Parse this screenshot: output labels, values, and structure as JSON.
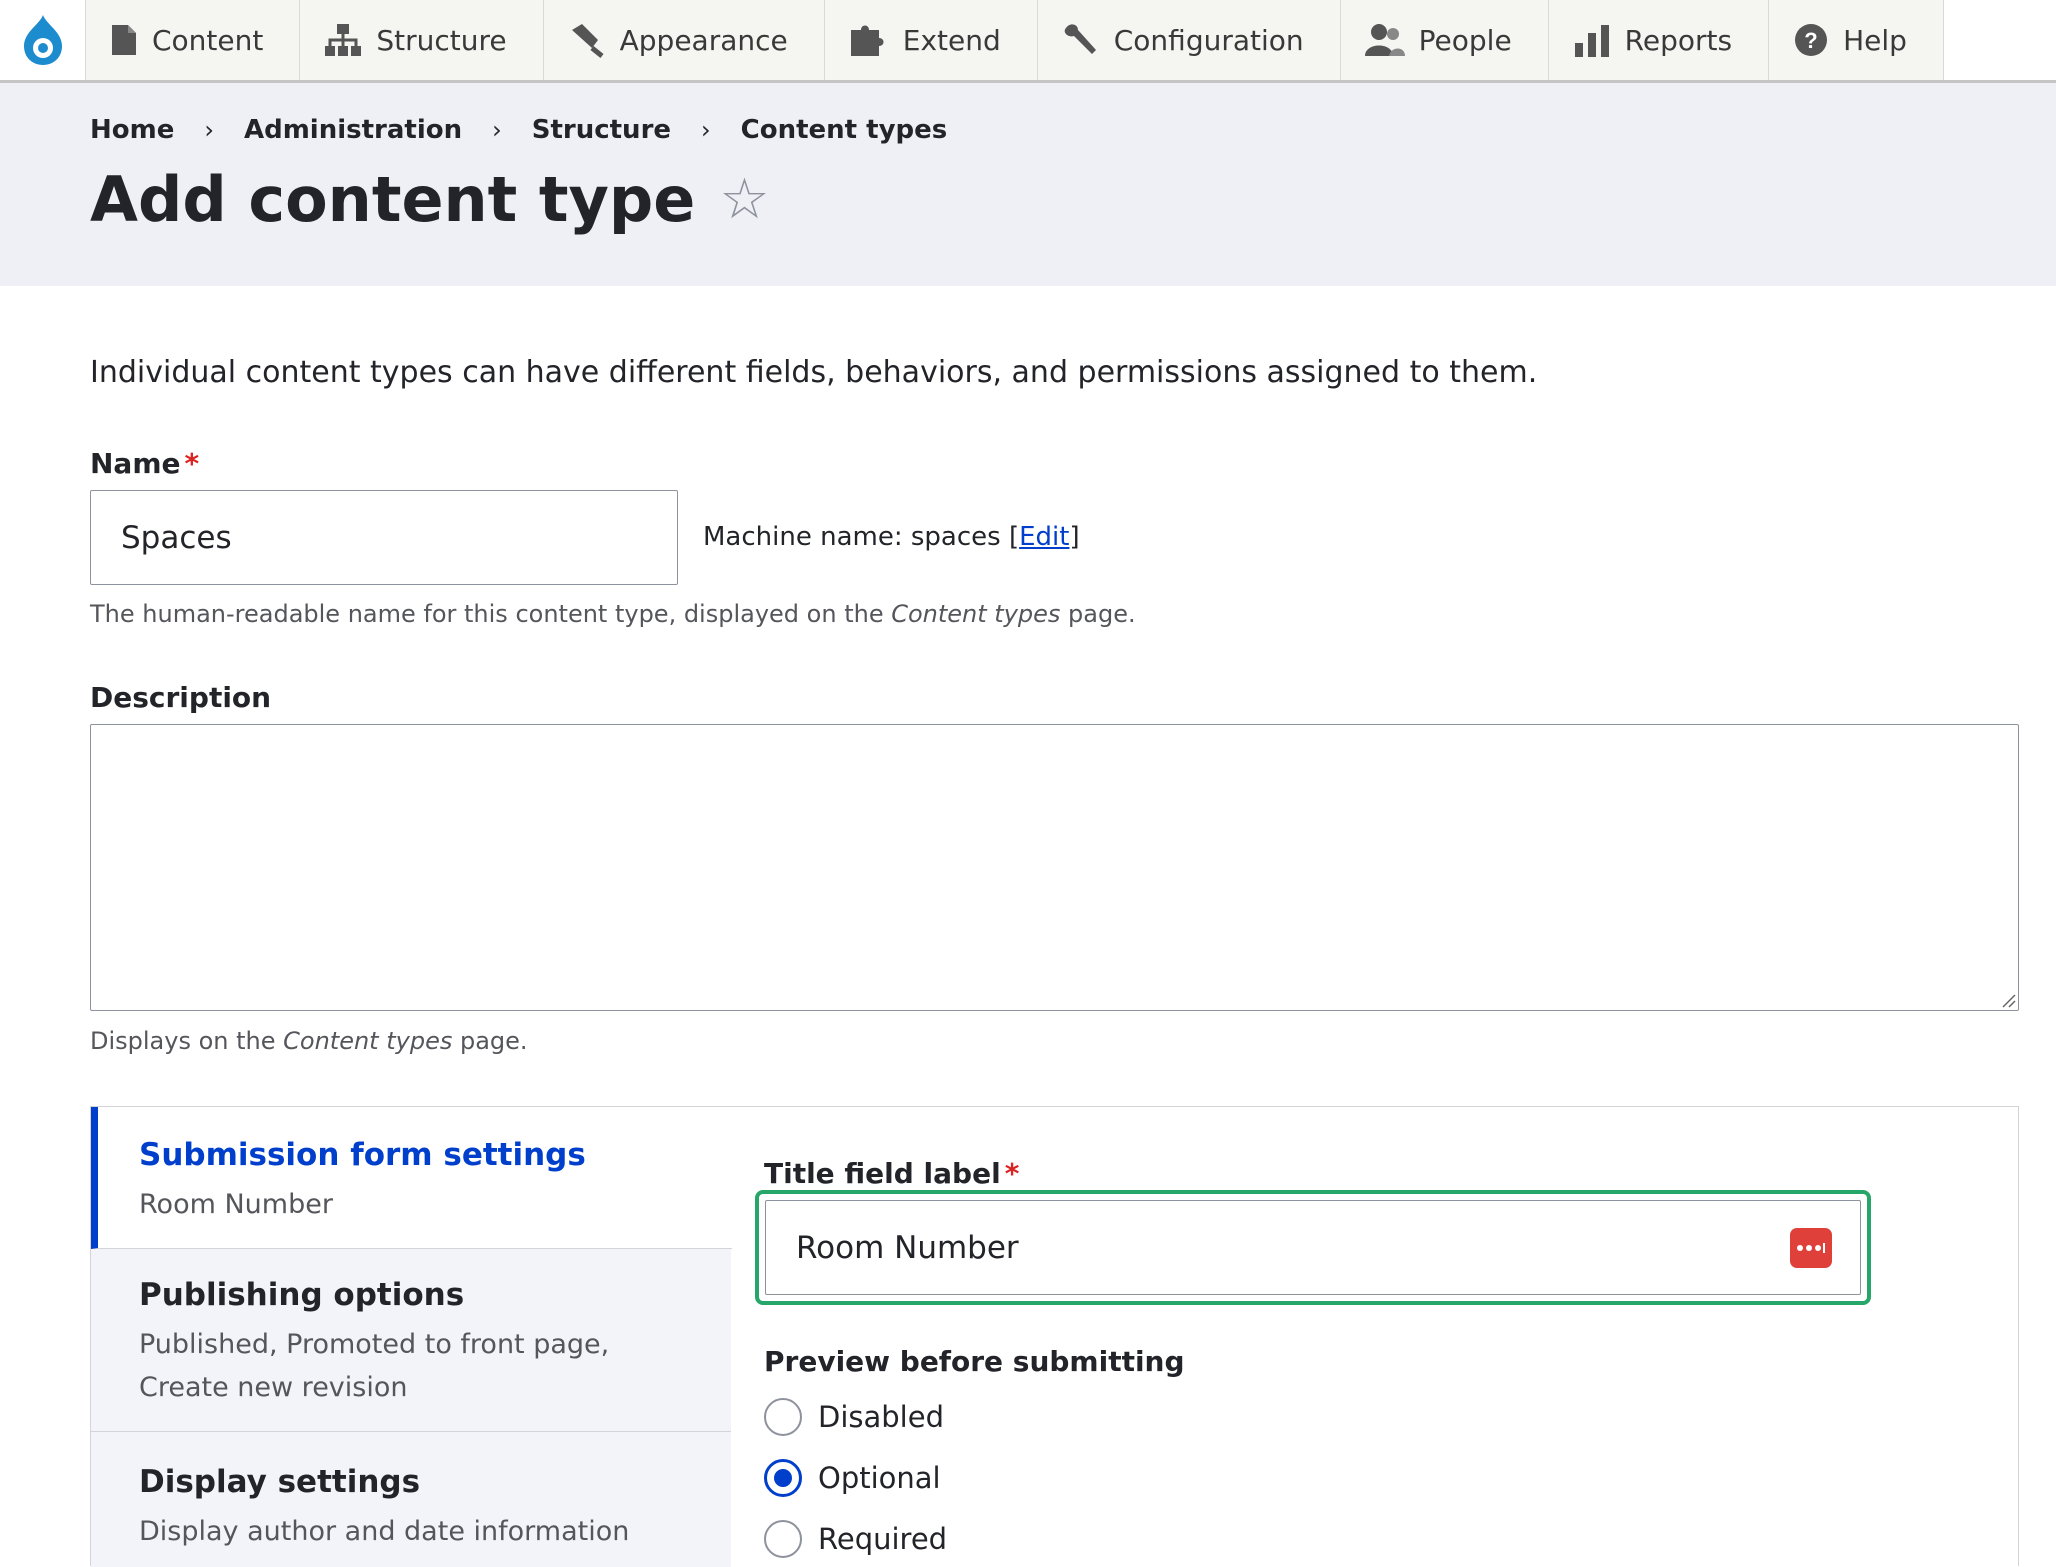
{
  "toolbar": {
    "items": [
      {
        "label": "Content",
        "icon": "file-icon"
      },
      {
        "label": "Structure",
        "icon": "sitemap-icon"
      },
      {
        "label": "Appearance",
        "icon": "paintbrush-icon"
      },
      {
        "label": "Extend",
        "icon": "puzzle-icon"
      },
      {
        "label": "Configuration",
        "icon": "wrench-icon"
      },
      {
        "label": "People",
        "icon": "people-icon"
      },
      {
        "label": "Reports",
        "icon": "bar-chart-icon"
      },
      {
        "label": "Help",
        "icon": "help-icon"
      }
    ]
  },
  "breadcrumb": [
    "Home",
    "Administration",
    "Structure",
    "Content types"
  ],
  "page": {
    "title": "Add content type",
    "intro": "Individual content types can have different fields, behaviors, and permissions assigned to them."
  },
  "form": {
    "name_label": "Name",
    "name_value": "Spaces",
    "machine_name_text": "Machine name: spaces",
    "machine_name_edit": "Edit",
    "name_help_prefix": "The human-readable name for this content type, displayed on the ",
    "name_help_em": "Content types",
    "name_help_suffix": " page.",
    "description_label": "Description",
    "description_value": "",
    "description_help_prefix": "Displays on the ",
    "description_help_em": "Content types",
    "description_help_suffix": " page."
  },
  "vertical_tabs": [
    {
      "title": "Submission form settings",
      "summary": "Room Number",
      "active": true
    },
    {
      "title": "Publishing options",
      "summary": "Published, Promoted to front page, Create new revision",
      "active": false
    },
    {
      "title": "Display settings",
      "summary": "Display author and date information",
      "active": false
    }
  ],
  "submission_pane": {
    "title_field_label": "Title field label",
    "title_field_value": "Room Number",
    "preview_label": "Preview before submitting",
    "preview_options": [
      "Disabled",
      "Optional",
      "Required"
    ],
    "preview_selected": "Optional"
  },
  "colors": {
    "accent": "#003ecc",
    "required": "#dc2323",
    "focus_ring": "#26a769",
    "header_bg": "#eef0f5",
    "password_manager": "#e0403a"
  }
}
